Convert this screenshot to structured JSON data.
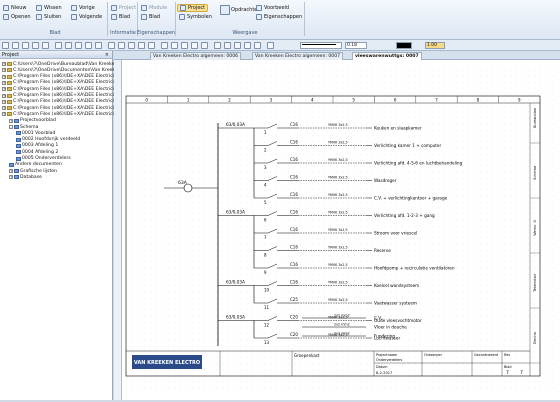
{
  "ribbon": {
    "groups": [
      {
        "label": "Blad"
      },
      {
        "label": "Informatie"
      },
      {
        "label": "Eigenschappen"
      },
      {
        "label": "Weergave"
      }
    ],
    "blad_buttons": [
      "Nieuw",
      "Openen",
      "Wissen",
      "Sluiten",
      "Vorige",
      "Volgende"
    ],
    "informatie_buttons": [
      "Project",
      "Blad"
    ],
    "eigenschappen_buttons": [
      "Module",
      "Blad"
    ],
    "weergave_buttons": [
      "Project",
      "Symbolen",
      "Opdrachten",
      "Voorbeeld",
      "Eigenschappen"
    ]
  },
  "toolbar": {
    "line_width": "0.18",
    "scale": "1.00"
  },
  "project_panel": {
    "title": "Project",
    "close": "×",
    "tree": [
      {
        "label": "C:\\Users\\?\\OneDrive\\Bureaublad\\Van Kreeken",
        "level": 0,
        "expand": "+",
        "kind": "folder"
      },
      {
        "label": "C:\\Users\\?\\OneDrive\\Documenten\\Van Kreeken",
        "level": 0,
        "expand": "+",
        "kind": "folder"
      },
      {
        "label": "C:\\Program Files (x86)\\IDE+XA\\DEE Electrici",
        "level": 0,
        "expand": "+",
        "kind": "folder"
      },
      {
        "label": "C:\\Program Files (x86)\\IDE+XA\\DEE Electrici",
        "level": 0,
        "expand": "+",
        "kind": "folder"
      },
      {
        "label": "C:\\Program Files (x86)\\IDE+XA\\DEE Electrici",
        "level": 0,
        "expand": "+",
        "kind": "folder"
      },
      {
        "label": "C:\\Program Files (x86)\\IDE+XA\\DEE Electrici",
        "level": 0,
        "expand": "+",
        "kind": "folder"
      },
      {
        "label": "C:\\Program Files (x86)\\IDE+XA\\DEE Electrici",
        "level": 0,
        "expand": "+",
        "kind": "folder"
      },
      {
        "label": "C:\\Program Files (x86)\\IDE+XA\\DEE Electrici",
        "level": 0,
        "expand": "+",
        "kind": "folder"
      },
      {
        "label": "C:\\Program Files (x86)\\IDE+XA\\DEE Electrici",
        "level": 0,
        "expand": "+",
        "kind": "folder"
      },
      {
        "label": "Projectvoorblad",
        "level": 1,
        "expand": "+",
        "kind": "book"
      },
      {
        "label": "Schema",
        "level": 1,
        "expand": "-",
        "kind": "book"
      },
      {
        "label": "0001 Voorblad",
        "level": 2,
        "expand": "",
        "kind": "page"
      },
      {
        "label": "0002 Hoofdvrijk verdeeld",
        "level": 2,
        "expand": "",
        "kind": "page"
      },
      {
        "label": "0003 Afdeling 1",
        "level": 2,
        "expand": "",
        "kind": "page"
      },
      {
        "label": "0004 Afdeling 2",
        "level": 2,
        "expand": "",
        "kind": "page"
      },
      {
        "label": "0005 Onderverdelers",
        "level": 2,
        "expand": "",
        "kind": "page"
      },
      {
        "label": "Andere documenten",
        "level": 1,
        "expand": "",
        "kind": "book"
      },
      {
        "label": "Grafische lijsten",
        "level": 1,
        "expand": "+",
        "kind": "book"
      },
      {
        "label": "Database",
        "level": 1,
        "expand": "+",
        "kind": "book"
      }
    ]
  },
  "tabs": [
    {
      "label": "Van Kreeken Electro algemeen: 0006",
      "active": false
    },
    {
      "label": "Van Kreeken Electro algemeen: 0007",
      "active": false
    },
    {
      "label": "vleeswarenwuttgs: 0007",
      "active": true
    }
  ],
  "schematic": {
    "columns": [
      "0",
      "1",
      "2",
      "3",
      "4",
      "5",
      "6",
      "7",
      "8",
      "9"
    ],
    "main_switch": "63A",
    "groups": [
      {
        "label": "63/0,03A",
        "first_row": 0,
        "rows": 5
      },
      {
        "label": "63/0,03A",
        "first_row": 5,
        "rows": 4
      },
      {
        "label": "63/0,03A",
        "first_row": 9,
        "rows": 2
      },
      {
        "label": "63/0,03A",
        "first_row": 11,
        "rows": 2
      }
    ],
    "rows": [
      {
        "num": "1",
        "rating": "C16",
        "cable": "YMVK 3x2,5",
        "desc": "Keuken en slaapkamer"
      },
      {
        "num": "2",
        "rating": "C16",
        "cable": "YMVK 3x2,5",
        "desc": "Verlichting kamer 1 + computer"
      },
      {
        "num": "3",
        "rating": "C16",
        "cable": "YMVK 3x2,5",
        "desc": "Verlichting afd. 4-5-6 en luchtbehandeling"
      },
      {
        "num": "4",
        "rating": "C16",
        "cable": "YMVK 3x2,5",
        "desc": "Wasdroger"
      },
      {
        "num": "5",
        "rating": "C16",
        "cable": "YMVK 3x2,5",
        "desc": "C.V. + verlichtingkantoor + garage"
      },
      {
        "num": "6",
        "rating": "C16",
        "cable": "YMVK 3x2,5",
        "desc": "Verlichting afd. 1-2-3 + gang"
      },
      {
        "num": "7",
        "rating": "C16",
        "cable": "YMVK 3x2,5",
        "desc": "Stroom voor vriescel"
      },
      {
        "num": "8",
        "rating": "C16",
        "cable": "YMVK 3x2,5",
        "desc": "Reserve"
      },
      {
        "num": "9",
        "rating": "C16",
        "cable": "YMVK 3x2,5",
        "desc": "Hoofdpomp + recirculatie ventilatoren"
      },
      {
        "num": "10",
        "rating": "C16",
        "cable": "YMVK 3x2,5",
        "desc": "Koelcel wandsysteem"
      },
      {
        "num": "11",
        "rating": "C25",
        "cable": "YMVK 3x2,5",
        "desc": "Vaatwasser systeem"
      },
      {
        "num": "12",
        "rating": "C20",
        "cable": "YMVK 3x2,5",
        "desc": "Oude vleesvochtmotor"
      },
      {
        "num": "13",
        "rating": "C20",
        "cable": "YMVK 3x2,5",
        "desc": "Luchtwasser"
      }
    ],
    "aux": [
      {
        "cable": "2x2 mm2",
        "desc": "C.V."
      },
      {
        "cable": "2x2 mm2",
        "desc": "Vloer in douche"
      },
      {
        "cable": "2x2 mm2",
        "desc": "Fundering"
      }
    ],
    "side_labels": [
      "Bureaublad",
      "Schema",
      "Werkn. 0",
      "Tekenblad",
      "Electro"
    ],
    "title_block": {
      "company": "VAN KREEKEN ELECTRO",
      "drawing": "Groepenkast",
      "project_label": "Projectnaam",
      "project_value": "Onderverdelers",
      "designer_label": "Ontwerper",
      "checked_label": "Gecontroleerd",
      "rev_label": "Rev",
      "sheet_label": "Blad",
      "date_label": "Datum",
      "date_value": "8-2-2017",
      "sheet_of": "7",
      "sheet_total": "7"
    }
  }
}
